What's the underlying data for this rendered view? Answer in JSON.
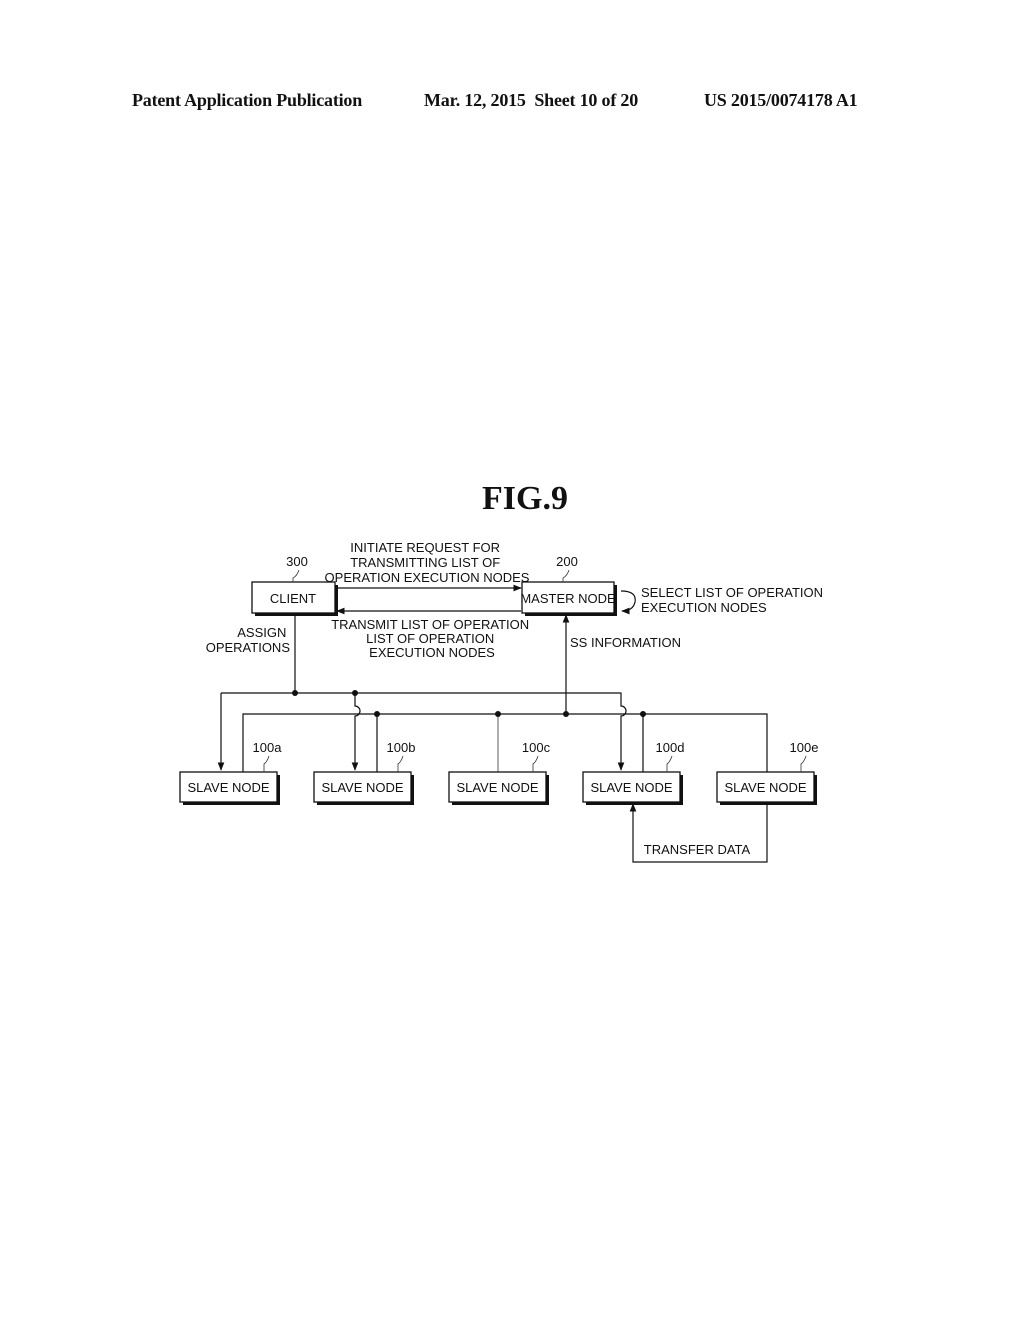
{
  "header": {
    "publication": "Patent Application Publication",
    "date_sheet": "Mar. 12, 2015  Sheet 10 of 20",
    "patent_number": "US 2015/0074178 A1"
  },
  "figure": {
    "title": "FIG.9",
    "client": {
      "ref": "300",
      "label": "CLIENT"
    },
    "master": {
      "ref": "200",
      "label": "MASTER NODE"
    },
    "request_label": [
      "INITIATE REQUEST FOR",
      "TRANSMITTING LIST OF",
      "OPERATION EXECUTION NODES"
    ],
    "transmit_label": [
      "TRANSMIT LIST OF OPERATION",
      "LIST OF OPERATION",
      "EXECUTION NODES"
    ],
    "select_label": [
      "SELECT LIST OF OPERATION",
      "EXECUTION NODES"
    ],
    "assign_label": [
      "ASSIGN",
      "OPERATIONS"
    ],
    "ss_label": "SS INFORMATION",
    "transfer_label": "TRANSFER DATA",
    "slaves": [
      {
        "ref": "100a",
        "label": "SLAVE NODE"
      },
      {
        "ref": "100b",
        "label": "SLAVE NODE"
      },
      {
        "ref": "100c",
        "label": "SLAVE NODE"
      },
      {
        "ref": "100d",
        "label": "SLAVE NODE"
      },
      {
        "ref": "100e",
        "label": "SLAVE NODE"
      }
    ]
  }
}
